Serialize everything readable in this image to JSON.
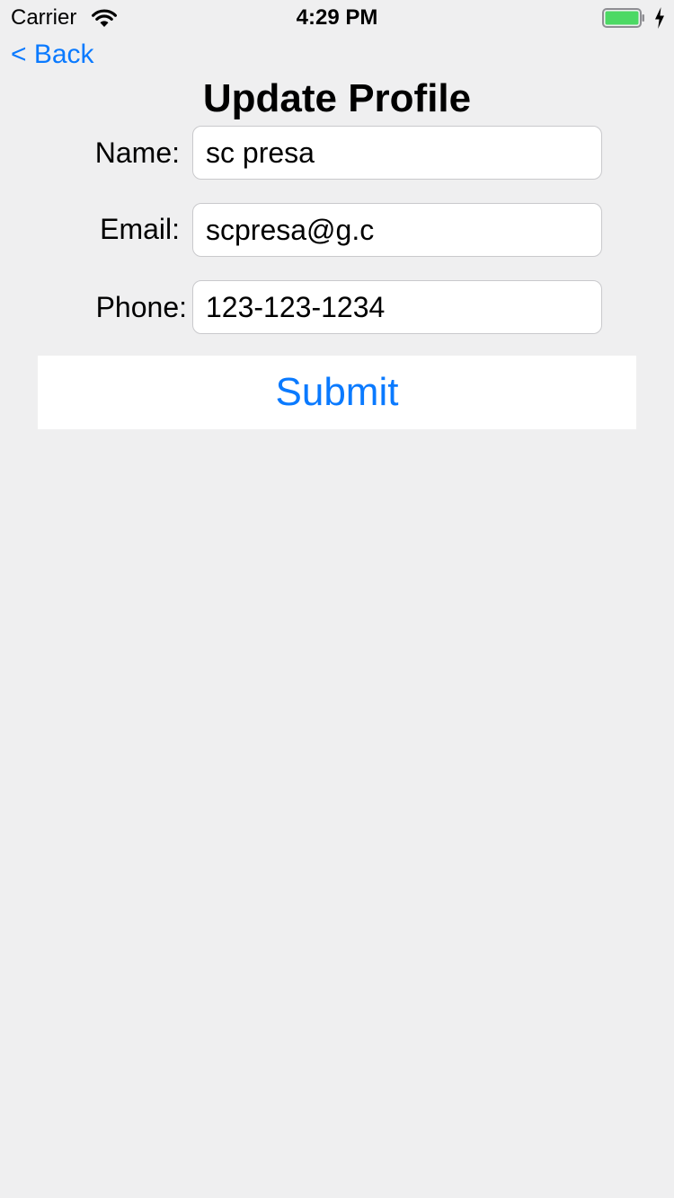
{
  "status_bar": {
    "carrier": "Carrier",
    "time": "4:29 PM",
    "battery_color": "#4cd964"
  },
  "nav": {
    "back_label": "< Back"
  },
  "page": {
    "title": "Update Profile"
  },
  "form": {
    "name": {
      "label": "Name:",
      "value": "sc presa"
    },
    "email": {
      "label": "Email:",
      "value": "scpresa@g.c"
    },
    "phone": {
      "label": "Phone:",
      "value": "123-123-1234"
    },
    "submit_label": "Submit"
  },
  "colors": {
    "accent": "#0a7aff",
    "background": "#efeff0"
  }
}
